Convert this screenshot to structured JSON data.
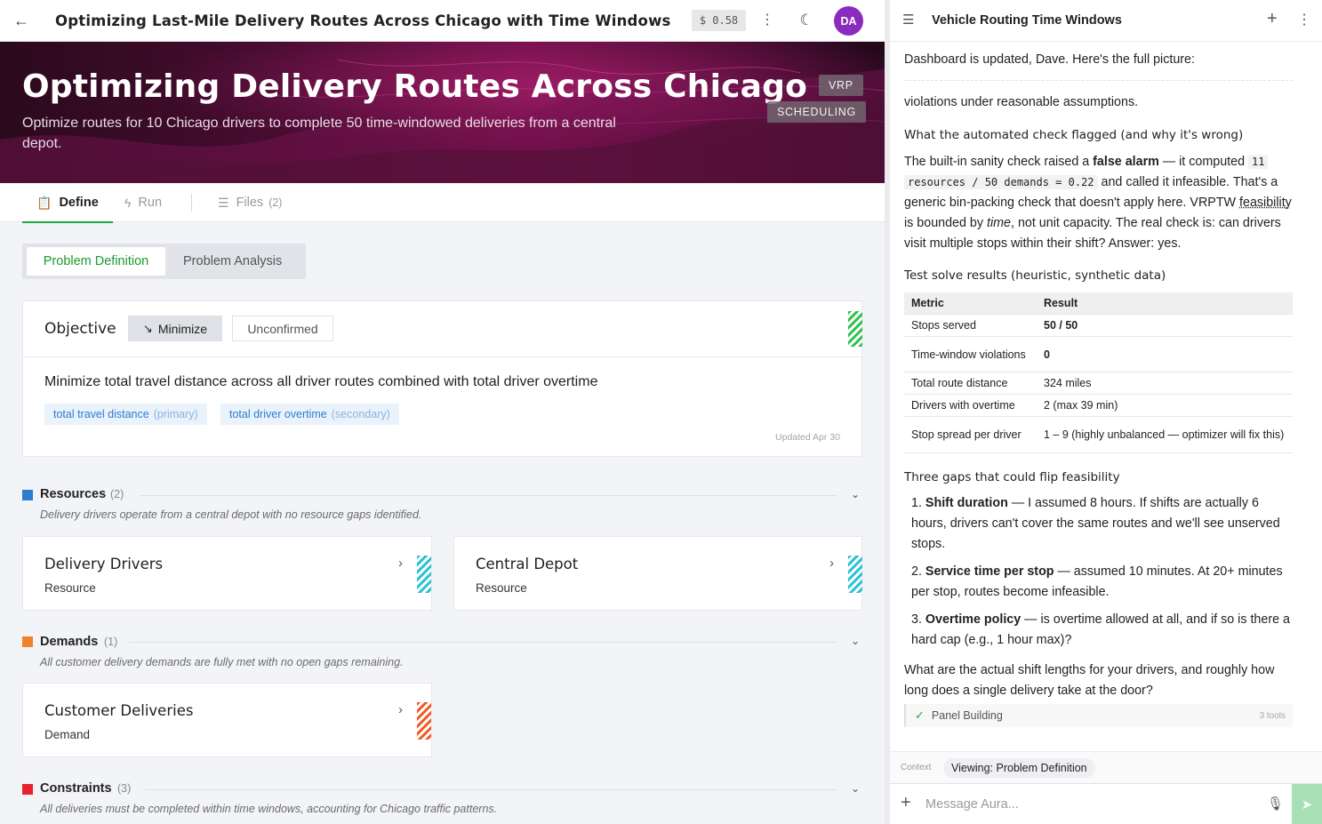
{
  "topbar": {
    "title": "Optimizing Last-Mile Delivery Routes Across Chicago with Time Windows",
    "cost": "$ 0.58",
    "avatar_initials": "DA"
  },
  "hero": {
    "title": "Optimizing Delivery Routes Across Chicago",
    "subtitle": "Optimize routes for 10 Chicago drivers to complete 50 time-windowed deliveries from a central depot.",
    "tags": [
      "VRP",
      "SCHEDULING"
    ]
  },
  "tabs": [
    {
      "label": "Define",
      "icon": "clipboard-icon"
    },
    {
      "label": "Run",
      "icon": "bolt-icon"
    },
    {
      "label": "Files",
      "count": "(2)",
      "icon": "database-icon"
    }
  ],
  "subtabs": [
    "Problem Definition",
    "Problem Analysis"
  ],
  "objective": {
    "label": "Objective",
    "direction": "Minimize",
    "status": "Unconfirmed",
    "text": "Minimize total travel distance across all driver routes combined with total driver overtime",
    "chips": [
      {
        "name": "total travel distance",
        "role": "(primary)"
      },
      {
        "name": "total driver overtime",
        "role": "(secondary)"
      }
    ],
    "updated": "Updated Apr 30",
    "stripe_color": "#2cc24c"
  },
  "sections": {
    "resources": {
      "title": "Resources",
      "count": "(2)",
      "color": "#2b7ed0",
      "desc": "Delivery drivers operate from a central depot with no resource gaps identified.",
      "items": [
        {
          "name": "Delivery Drivers",
          "type": "Resource"
        },
        {
          "name": "Central Depot",
          "type": "Resource"
        }
      ],
      "stripe_color": "#26c2d0"
    },
    "demands": {
      "title": "Demands",
      "count": "(1)",
      "color": "#f0822d",
      "desc": "All customer delivery demands are fully met with no open gaps remaining.",
      "items": [
        {
          "name": "Customer Deliveries",
          "type": "Demand"
        }
      ],
      "stripe_color": "#ee5a24"
    },
    "constraints": {
      "title": "Constraints",
      "count": "(3)",
      "color": "#e8222e",
      "desc": "All deliveries must be completed within time windows, accounting for Chicago traffic patterns."
    }
  },
  "chat": {
    "title": "Vehicle Routing Time Windows",
    "intro": "Dashboard is updated, Dave. Here's the full picture:",
    "violations": "violations under reasonable assumptions.",
    "h1": "What the automated check flagged (and why it's wrong)",
    "p1": {
      "a": "The built-in sanity check raised a ",
      "b": "false alarm",
      "c": " — it computed ",
      "code1": "11",
      "code2": "resources / 50 demands = 0.22",
      "d": " and called it infeasible. That's a generic bin-packing check that doesn't apply here. VRPTW ",
      "e": "feasibility",
      "f": " is bounded by ",
      "g": "time",
      "h": ", not unit capacity. The real check is: can drivers visit multiple stops within their shift? Answer: yes."
    },
    "h2": "Test solve results (heuristic, synthetic data)",
    "table": {
      "headers": [
        "Metric",
        "Result"
      ],
      "rows": [
        [
          "Stops served",
          "50 / 50"
        ],
        [
          "Time-window violations",
          "0"
        ],
        [
          "Total route distance",
          "324 miles"
        ],
        [
          "Drivers with overtime",
          "2 (max 39 min)"
        ],
        [
          "Stop spread per driver",
          "1 – 9 (highly unbalanced — optimizer will fix this)"
        ]
      ]
    },
    "h3": "Three gaps that could flip feasibility",
    "gaps": [
      {
        "num": "1.",
        "bold": "Shift duration",
        "text": " — I assumed 8 hours. If shifts are actually 6 hours, drivers can't cover the same routes and we'll see unserved stops."
      },
      {
        "num": "2.",
        "bold": "Service time per stop",
        "text": " — assumed 10 minutes. At 20+ minutes per stop, routes become infeasible."
      },
      {
        "num": "3.",
        "bold": "Overtime policy",
        "text": " — is overtime allowed at all, and if so is there a hard cap (e.g., 1 hour max)?"
      }
    ],
    "question": "What are the actual shift lengths for your drivers, and roughly how long does a single delivery take at the door?",
    "panel_building": "Panel Building",
    "tools": "3 tools",
    "context_label": "Context",
    "context_value": "Viewing: Problem Definition",
    "input_placeholder": "Message Aura..."
  }
}
